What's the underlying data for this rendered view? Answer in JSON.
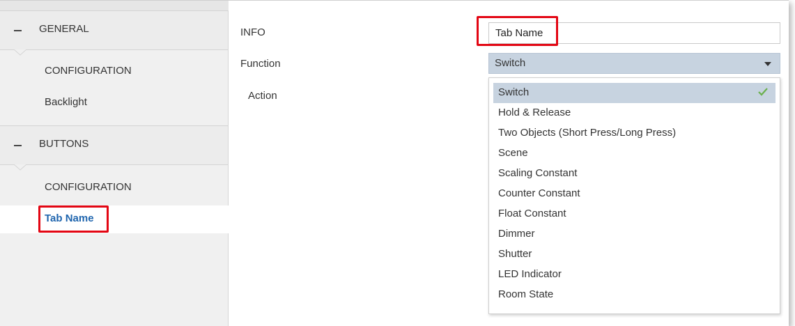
{
  "sidebar": {
    "groups": [
      {
        "label": "GENERAL",
        "items": [
          "CONFIGURATION",
          "Backlight"
        ]
      },
      {
        "label": "BUTTONS",
        "items": [
          "CONFIGURATION",
          "Tab Name"
        ]
      }
    ],
    "active_item": "Tab Name"
  },
  "main": {
    "info_label": "INFO",
    "info_value": "Tab Name",
    "function_label": "Function",
    "function_value": "Switch",
    "action_label": "Action",
    "options": [
      "Switch",
      "Hold & Release",
      "Two Objects (Short Press/Long Press)",
      "Scene",
      "Scaling Constant",
      "Counter Constant",
      "Float Constant",
      "Dimmer",
      "Shutter",
      "LED Indicator",
      "Room State"
    ],
    "selected_option": "Switch"
  },
  "colors": {
    "highlight": "#e30613",
    "selection": "#c7d3e0",
    "active_link": "#1f65ae",
    "check": "#6ab04c"
  },
  "icons": [
    "minus-icon",
    "dropdown-arrow-icon",
    "checkmark-icon"
  ]
}
